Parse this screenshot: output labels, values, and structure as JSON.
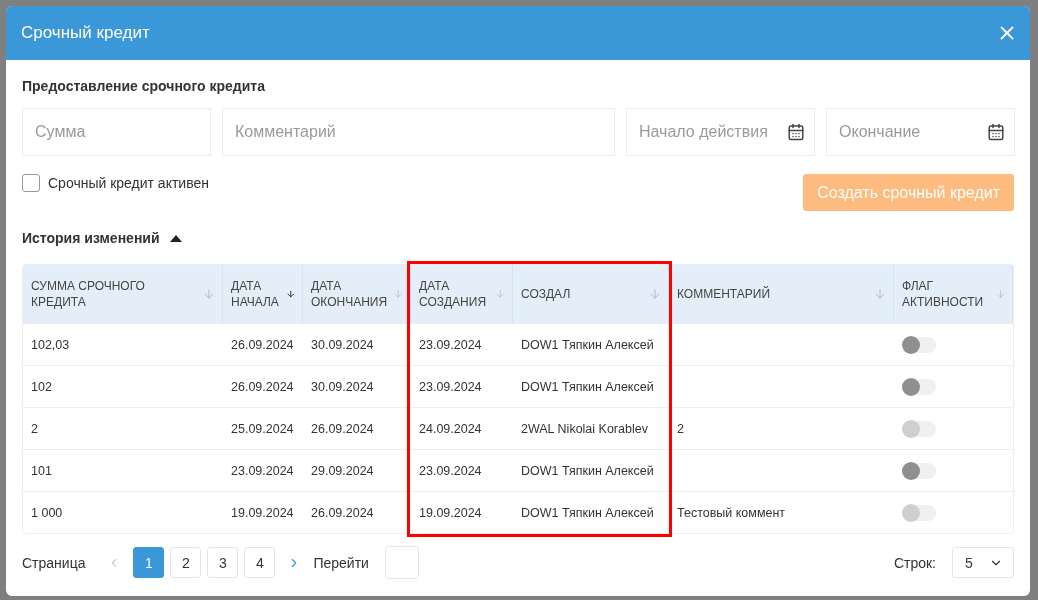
{
  "dialog": {
    "title": "Срочный кредит",
    "section_title": "Предоставление срочного кредита",
    "fields": [
      {
        "kind": "text",
        "placeholder": "Сумма"
      },
      {
        "kind": "text",
        "placeholder": "Комментарий"
      },
      {
        "kind": "date",
        "placeholder": "Начало действия"
      },
      {
        "kind": "date",
        "placeholder": "Окончание"
      }
    ],
    "active_checkbox": {
      "label": "Срочный кредит активен",
      "checked": false
    },
    "create_button": {
      "label": "Создать срочный кредит",
      "disabled": true
    },
    "history": {
      "title": "История изменений",
      "expanded": true
    },
    "table": {
      "columns": [
        {
          "label": "СУММА СРОЧНОГО КРЕДИТА",
          "sorted": false,
          "highlighted": false
        },
        {
          "label": "ДАТА НАЧАЛА",
          "sorted": true,
          "highlighted": false
        },
        {
          "label": "ДАТА ОКОНЧАНИЯ",
          "sorted": false,
          "highlighted": false
        },
        {
          "label": "ДАТА СОЗДАНИЯ",
          "sorted": false,
          "highlighted": true
        },
        {
          "label": "СОЗДАЛ",
          "sorted": false,
          "highlighted": true
        },
        {
          "label": "КОММЕНТАРИЙ",
          "sorted": false,
          "highlighted": false
        },
        {
          "label": "ФЛАГ АКТИВНОСТИ",
          "sorted": false,
          "highlighted": false
        }
      ],
      "rows": [
        {
          "cells": [
            "102,03",
            "26.09.2024",
            "30.09.2024",
            "23.09.2024",
            "DOW1 Тяпкин Алексей",
            ""
          ],
          "active": false,
          "disabled": false
        },
        {
          "cells": [
            "102",
            "26.09.2024",
            "30.09.2024",
            "23.09.2024",
            "DOW1 Тяпкин Алексей",
            ""
          ],
          "active": false,
          "disabled": false
        },
        {
          "cells": [
            "2",
            "25.09.2024",
            "26.09.2024",
            "24.09.2024",
            "2WAL Nikolai Korablev",
            "2"
          ],
          "active": false,
          "disabled": true
        },
        {
          "cells": [
            "101",
            "23.09.2024",
            "29.09.2024",
            "23.09.2024",
            "DOW1 Тяпкин Алексей",
            ""
          ],
          "active": false,
          "disabled": false
        },
        {
          "cells": [
            "1 000",
            "19.09.2024",
            "26.09.2024",
            "19.09.2024",
            "DOW1 Тяпкин Алексей",
            "Тестовый коммент"
          ],
          "active": false,
          "disabled": true
        }
      ]
    },
    "pagination": {
      "label": "Страница",
      "pages": [
        {
          "label": "1",
          "selected": true
        },
        {
          "label": "2",
          "selected": false
        },
        {
          "label": "3",
          "selected": false
        },
        {
          "label": "4",
          "selected": false
        }
      ],
      "goto_label": "Перейти",
      "rows_label": "Строк:",
      "rows_value": "5"
    }
  }
}
